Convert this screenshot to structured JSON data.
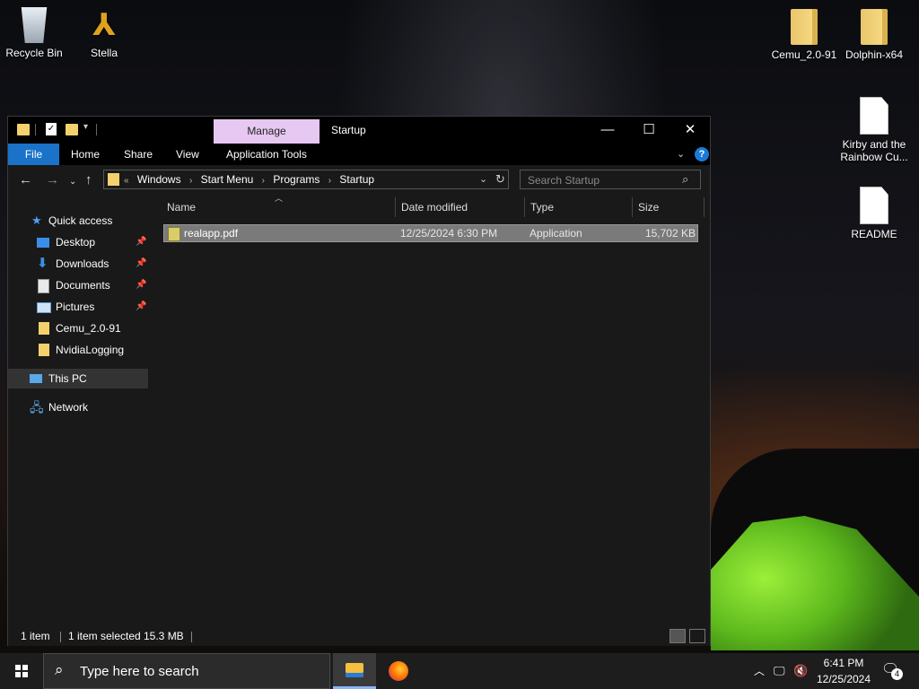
{
  "desktop": {
    "icons_left": [
      {
        "label": "Recycle Bin"
      },
      {
        "label": "Stella"
      }
    ],
    "icons_right": [
      {
        "label": "Cemu_2.0-91"
      },
      {
        "label": "Dolphin-x64"
      },
      {
        "label": "Kirby and the Rainbow Cu..."
      },
      {
        "label": "README"
      }
    ]
  },
  "window": {
    "title": "Startup",
    "context_tab": "Manage",
    "ribbon_tabs": [
      "File",
      "Home",
      "Share",
      "View",
      "Application Tools"
    ],
    "controls": {
      "minimize": "—",
      "maximize": "☐",
      "close": "✕"
    },
    "help": "?"
  },
  "address": {
    "overflow": "«",
    "crumbs": [
      "Windows",
      "Start Menu",
      "Programs",
      "Startup"
    ]
  },
  "search": {
    "placeholder": "Search Startup"
  },
  "nav": {
    "quick_access": "Quick access",
    "items": [
      {
        "label": "Desktop",
        "pinned": true
      },
      {
        "label": "Downloads",
        "pinned": true
      },
      {
        "label": "Documents",
        "pinned": true
      },
      {
        "label": "Pictures",
        "pinned": true
      },
      {
        "label": "Cemu_2.0-91",
        "pinned": false
      },
      {
        "label": "NvidiaLogging",
        "pinned": false
      }
    ],
    "this_pc": "This PC",
    "network": "Network"
  },
  "table": {
    "columns": [
      "Name",
      "Date modified",
      "Type",
      "Size"
    ],
    "rows": [
      {
        "name": "realapp.pdf",
        "date": "12/25/2024 6:30 PM",
        "type": "Application",
        "size": "15,702 KB"
      }
    ]
  },
  "status": {
    "count": "1 item",
    "selected": "1 item selected",
    "size": "15.3 MB"
  },
  "taskbar": {
    "search_text": "Type here to search",
    "time": "6:41 PM",
    "date": "12/25/2024",
    "notifications": "4"
  }
}
